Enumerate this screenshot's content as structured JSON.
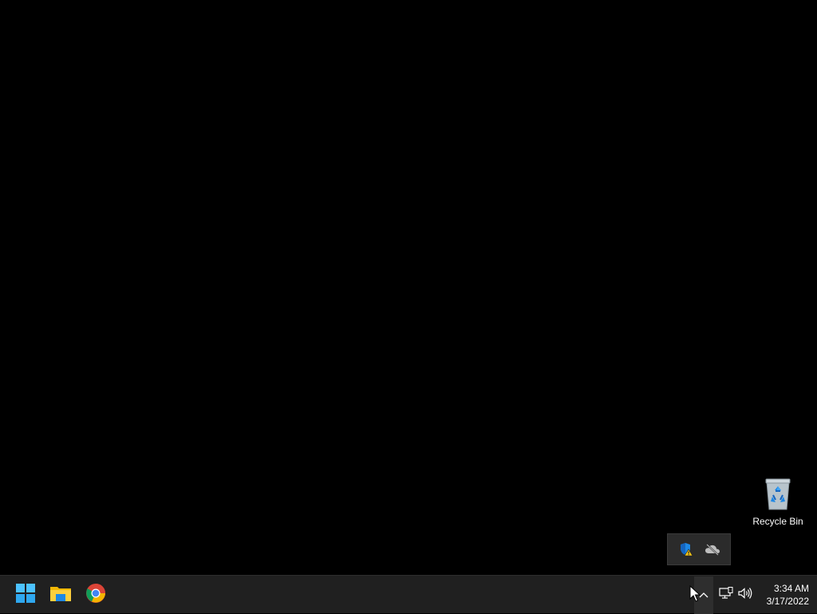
{
  "desktop": {
    "background": "#000000",
    "icons": [
      {
        "label": "Recycle Bin",
        "icon": "recycle-bin-icon"
      }
    ]
  },
  "tray_overflow": {
    "icons": [
      {
        "icon": "windows-security-warning-icon"
      },
      {
        "icon": "onedrive-offline-icon"
      }
    ]
  },
  "taskbar": {
    "background": "#202020",
    "apps": [
      {
        "icon": "windows-start-icon"
      },
      {
        "icon": "file-explorer-icon"
      },
      {
        "icon": "chrome-icon"
      }
    ],
    "tray": {
      "icons": [
        "show-hidden-icons-chevron",
        "network-icon",
        "volume-icon"
      ]
    },
    "clock": {
      "time": "3:34 AM",
      "date": "3/17/2022"
    }
  }
}
